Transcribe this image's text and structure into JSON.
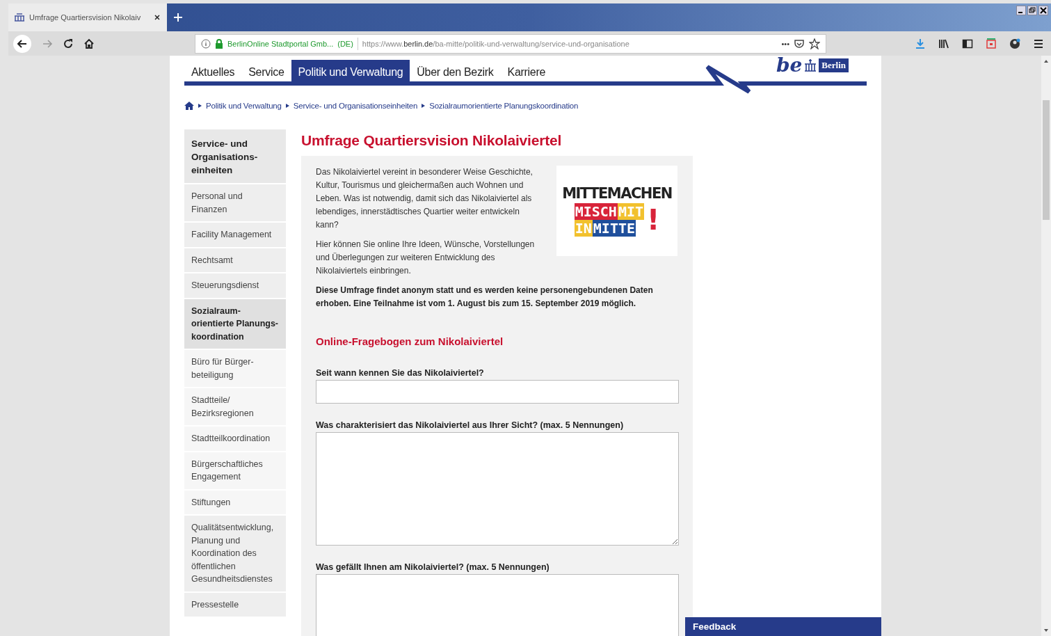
{
  "browser": {
    "tab_title": "Umfrage Quartiersvision Nikolaiv",
    "identity": "BerlinOnline Stadtportal Gmb...",
    "identity_country": "(DE)",
    "url_prefix": "https://www.",
    "url_domain": "berlin.de",
    "url_path": "/ba-mitte/politik-und-verwaltung/service-und-organisatione",
    "more": "•••"
  },
  "nav": {
    "tabs": [
      {
        "label": "Aktuelles",
        "selected": false
      },
      {
        "label": "Service",
        "selected": false
      },
      {
        "label": "Politik und Verwaltung",
        "selected": true
      },
      {
        "label": "Über den Bezirk",
        "selected": false
      },
      {
        "label": "Karriere",
        "selected": false
      }
    ],
    "logo": {
      "prefix": "be",
      "name": "Berlin"
    }
  },
  "breadcrumb": [
    "Politik und Verwaltung",
    "Service- und Organisationseinheiten",
    "Sozialraumorientierte Planungskoordination"
  ],
  "sidebar": {
    "heading": "Service- und Organisations-einheiten",
    "items": [
      {
        "label": "Personal und Finanzen",
        "selected": false
      },
      {
        "label": "Facility Management",
        "selected": false
      },
      {
        "label": "Rechtsamt",
        "selected": false
      },
      {
        "label": "Steuerungsdienst",
        "selected": false
      },
      {
        "label": "Sozialraum-orientierte Planungs-koordination",
        "selected": true,
        "children": [
          {
            "label": "Büro für Bürger-beteiligung",
            "selected": false
          },
          {
            "label": "Stadtteile/ Bezirksregionen",
            "selected": false
          },
          {
            "label": "Stadtteilkoordination",
            "selected": false
          },
          {
            "label": "Bürgerschaftliches Engagement",
            "selected": false
          },
          {
            "label": "Stiftungen",
            "selected": false
          }
        ]
      },
      {
        "label": "Qualitätsentwicklung, Planung und Koordination des öffentlichen Gesundheitsdienstes",
        "selected": false
      },
      {
        "label": "Pressestelle",
        "selected": false
      }
    ]
  },
  "article": {
    "title": "Umfrage Quartiersvision Nikolaiviertel",
    "paragraphs": [
      "Das Nikolaiviertel vereint in besonderer Weise Geschichte, Kultur, Tourismus und gleichermaßen auch Wohnen und Leben. Was ist notwendig, damit sich das Nikolaiviertel als lebendiges, innerstädtisches Quartier weiter entwickeln kann?",
      "Hier können Sie online Ihre Ideen, Wünsche, Vorstellungen und Überlegungen zur weiteren Entwicklung des Nikolaiviertels einbringen."
    ],
    "notice": "Diese Umfrage findet anonym statt und es werden keine personengebundenen Daten erhoben. Eine Teilnahme ist vom 1. August bis zum 15. September 2019 möglich.",
    "campaign_logo": {
      "headline": "MITTEMACHEN",
      "rows": [
        [
          {
            "text": "MISCH",
            "color": "#d8243a"
          },
          {
            "text": "MIT",
            "color": "#f2c12e"
          }
        ],
        [
          {
            "text": "IN",
            "color": "#f2c12e"
          },
          {
            "text": "MITTE",
            "color": "#1f4f9c"
          }
        ]
      ],
      "mark": "!"
    },
    "form": {
      "title": "Online-Fragebogen zum Nikolaiviertel",
      "questions": [
        {
          "label": "Seit wann kennen Sie das Nikolaiviertel?",
          "kind": "line"
        },
        {
          "label": "Was charakterisiert das Nikolaiviertel aus Ihrer Sicht? (max. 5 Nennungen)",
          "kind": "area"
        },
        {
          "label": "Was gefällt Ihnen am Nikolaiviertel? (max. 5 Nennungen)",
          "kind": "area"
        }
      ]
    }
  },
  "feedback": "Feedback"
}
